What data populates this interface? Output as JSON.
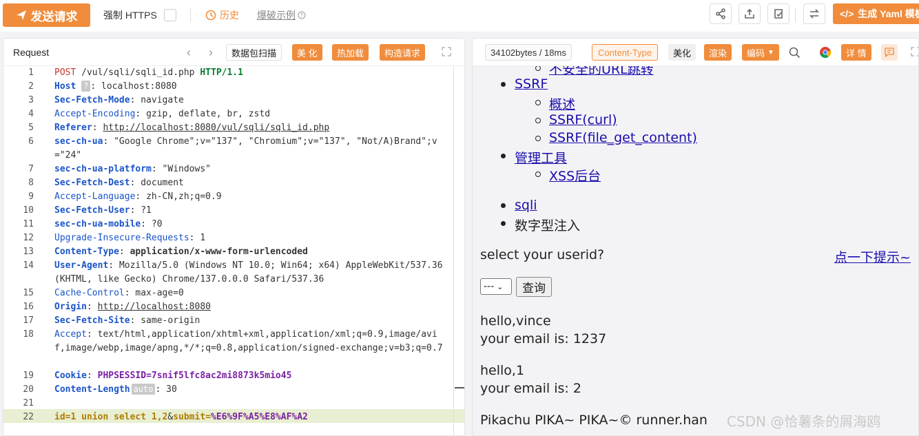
{
  "toolbar": {
    "send_label": "发送请求",
    "https_label": "强制 HTTPS",
    "history_label": "历史",
    "blast_label": "爆破示例",
    "yaml_label": "生成 Yaml 模板"
  },
  "request": {
    "title": "Request",
    "buttons": {
      "packet_scan": "数据包扫描",
      "beautify": "美 化",
      "hot_load": "热加载",
      "construct": "构造请求"
    },
    "lines": [
      {
        "n": "1"
      },
      {
        "n": "2"
      },
      {
        "n": "3"
      },
      {
        "n": "4"
      },
      {
        "n": "5"
      },
      {
        "n": "6"
      },
      {
        "n": "7"
      },
      {
        "n": "8"
      },
      {
        "n": "9"
      },
      {
        "n": "10"
      },
      {
        "n": "11"
      },
      {
        "n": "12"
      },
      {
        "n": "13"
      },
      {
        "n": "14"
      },
      {
        "n": "15"
      },
      {
        "n": "16"
      },
      {
        "n": "17"
      },
      {
        "n": "18"
      },
      {
        "n": "19"
      },
      {
        "n": "20"
      },
      {
        "n": "21"
      },
      {
        "n": "22"
      }
    ],
    "method": "POST",
    "path": "/vul/sqli/sqli_id.php",
    "version": "HTTP/1.1",
    "headers": {
      "host_key": "Host",
      "host_badge": "?",
      "host_val": "localhost:8080",
      "sfm_key": "Sec-Fetch-Mode",
      "sfm_val": "navigate",
      "ae_key": "Accept-Encoding",
      "ae_val": "gzip, deflate, br, zstd",
      "ref_key": "Referer",
      "ref_val": "http://localhost:8080/vul/sqli/sqli_id.php",
      "ua_key": "sec-ch-ua",
      "ua_val": "\"Google Chrome\";v=\"137\", \"Chromium\";v=\"137\", \"Not/A)Brand\";v=\"24\"",
      "plat_key": "sec-ch-ua-platform",
      "plat_val": "\"Windows\"",
      "sfd_key": "Sec-Fetch-Dest",
      "sfd_val": "document",
      "al_key": "Accept-Language",
      "al_val": "zh-CN,zh;q=0.9",
      "sfu_key": "Sec-Fetch-User",
      "sfu_val": "?1",
      "mob_key": "sec-ch-ua-mobile",
      "mob_val": "?0",
      "uir_key": "Upgrade-Insecure-Requests",
      "uir_val": "1",
      "ct_key": "Content-Type",
      "ct_val": "application/x-www-form-urlencoded",
      "agent_key": "User-Agent",
      "agent_val": "Mozilla/5.0 (Windows NT 10.0; Win64; x64) AppleWebKit/537.36 (KHTML, like Gecko) Chrome/137.0.0.0 Safari/537.36",
      "cc_key": "Cache-Control",
      "cc_val": "max-age=0",
      "origin_key": "Origin",
      "origin_val": "http://localhost:8080",
      "sfs_key": "Sec-Fetch-Site",
      "sfs_val": "same-origin",
      "accept_key": "Accept",
      "accept_val": "text/html,application/xhtml+xml,application/xml;q=0.9,image/avif,image/webp,image/apng,*/*;q=0.8,application/signed-exchange;v=b3;q=0.7",
      "cookie_key": "Cookie",
      "cookie_name": "PHPSESSID",
      "cookie_val": "7snif5lfc8ac2mi8873k5mio45",
      "cl_key": "Content-Length",
      "cl_badge": "auto",
      "cl_val": "30"
    },
    "body": {
      "k1": "id",
      "v1": "1 union select 1,2",
      "amp": "&",
      "k2": "submit",
      "v2": "%E6%9F%A5%E8%AF%A2"
    }
  },
  "response": {
    "stats": "34102bytes / 18ms",
    "buttons": {
      "content_type": "Content-Type",
      "beautify": "美化",
      "render": "渲染",
      "encoding": "编码",
      "detail": "详 情"
    },
    "render": {
      "cut_link": "不安全的URL跳转",
      "ssrf": "SSRF",
      "ssrf_items": [
        "概述",
        "SSRF(curl)",
        "SSRF(file_get_content)"
      ],
      "admin": "管理工具",
      "admin_items": [
        "XSS后台"
      ],
      "crumb1": "sqli",
      "crumb2": "数字型注入",
      "question": "select your userid?",
      "hint": "点一下提示~",
      "select_value": "---",
      "query_btn": "查询",
      "r1_hello": "hello,vince",
      "r1_email": "your email is: 1237",
      "r2_hello": "hello,1",
      "r2_email": "your email is: 2",
      "footer": "Pikachu PIKA~ PIKA~© runner.han",
      "watermark": "CSDN @恰薯条的屑海鸥"
    }
  },
  "colors": {
    "accent": "#f08c3b",
    "header_key": "#1a54c9",
    "cookie_purple": "#7a1fa2"
  }
}
